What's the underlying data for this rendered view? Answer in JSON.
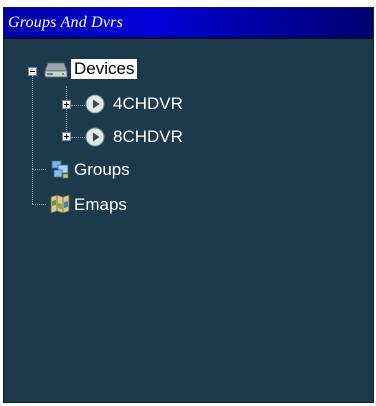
{
  "panel": {
    "title": "Groups And Dvrs"
  },
  "tree": {
    "root": {
      "label": "Devices",
      "icon": "device-drive-icon",
      "expanded": true,
      "selected": true
    },
    "devices": [
      {
        "label": "4CHDVR",
        "icon": "dvr-play-icon",
        "expander": "plus"
      },
      {
        "label": "8CHDVR",
        "icon": "dvr-play-icon",
        "expander": "plus"
      }
    ],
    "groups": {
      "label": "Groups",
      "icon": "groups-icon"
    },
    "emaps": {
      "label": "Emaps",
      "icon": "map-icon"
    }
  },
  "colors": {
    "title_bar": "#0000c8",
    "panel_background": "#1d3a4d",
    "text": "#ffffff",
    "selected_background": "#ffffff"
  }
}
